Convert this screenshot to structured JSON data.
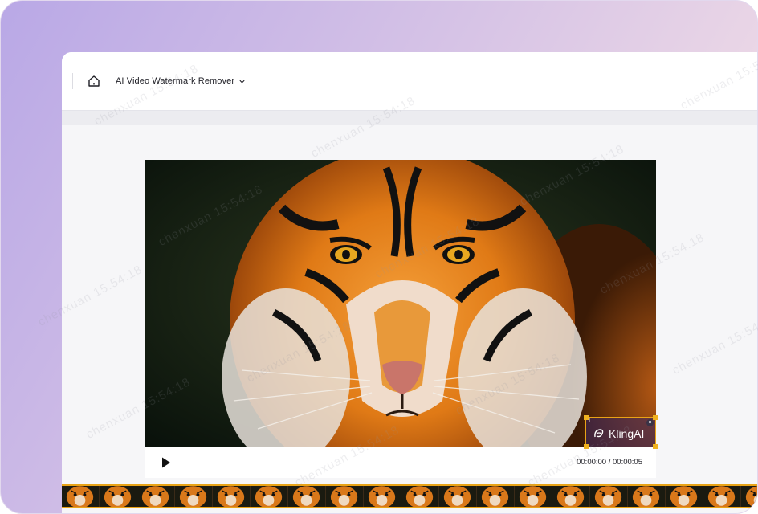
{
  "header": {
    "tool_name": "AI Video Watermark Remover"
  },
  "player": {
    "current_time": "00:00:00",
    "separator": " / ",
    "total_time": "00:00:05"
  },
  "watermark_selection": {
    "index": "1",
    "logo_text": "KlingAI",
    "close_symbol": "×"
  },
  "overlay": {
    "text": "chenxuan 15:54:18"
  },
  "colors": {
    "accent": "#e8a317",
    "frame_gradient_start": "#b9a8e6",
    "frame_gradient_end": "#f1dde4"
  },
  "icons": {
    "home": "home-icon",
    "chevron": "chevron-down-icon",
    "play": "play-icon",
    "close": "close-icon",
    "kling": "kling-logo-icon"
  }
}
